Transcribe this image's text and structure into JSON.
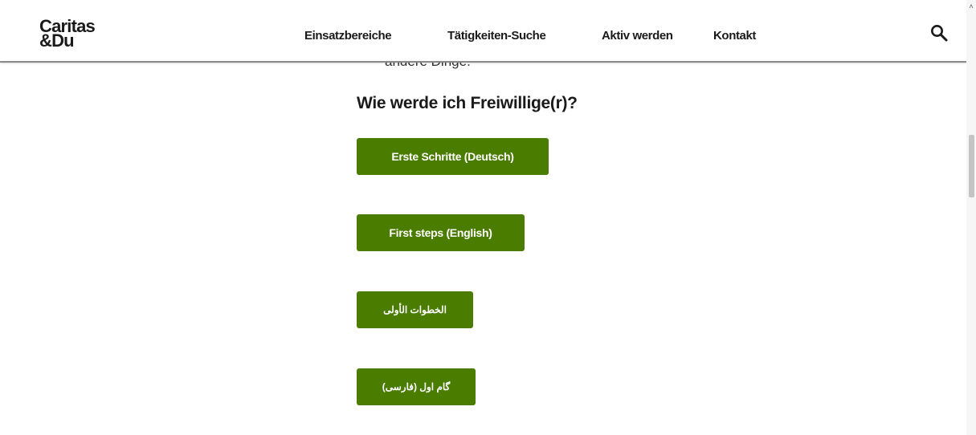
{
  "header": {
    "logo_line1": "Caritas",
    "logo_line2": "&Du",
    "nav": [
      {
        "label": "Einsatzbereiche"
      },
      {
        "label": "Tätigkeiten-Suche"
      },
      {
        "label": "Aktiv werden"
      },
      {
        "label": "Kontakt"
      }
    ],
    "search_icon": "search-icon"
  },
  "main": {
    "partial_text": "andere Dinge.",
    "heading": "Wie werde ich Freiwillige(r)?",
    "buttons": [
      {
        "label": "Erste Schritte (Deutsch)"
      },
      {
        "label": "First steps (English)"
      },
      {
        "label": "الخطوات الأولى"
      },
      {
        "label": "گام اول (فارسی)"
      }
    ]
  },
  "colors": {
    "button_green": "#4a7c00",
    "text_dark": "#1a1a1a"
  }
}
